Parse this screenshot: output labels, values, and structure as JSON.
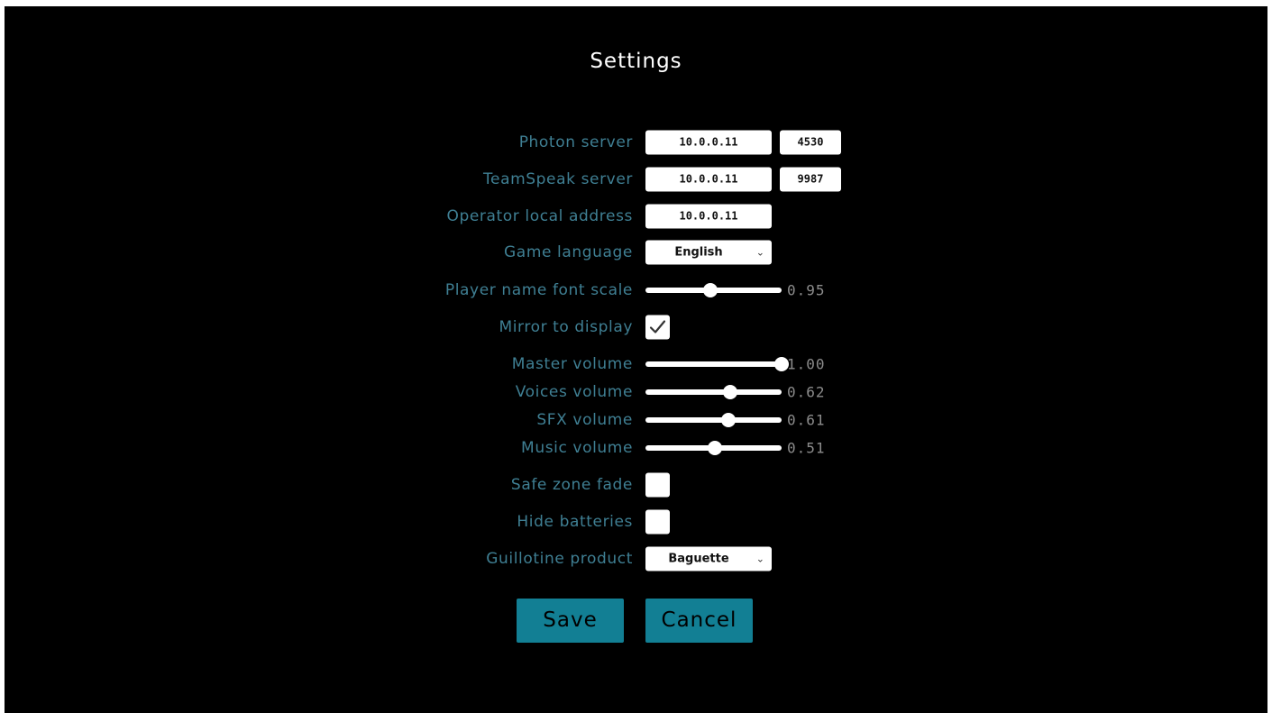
{
  "title": "Settings",
  "photon_server": {
    "label": "Photon server",
    "address": "10.0.0.11",
    "port": "4530"
  },
  "teamspeak_server": {
    "label": "TeamSpeak server",
    "address": "10.0.0.11",
    "port": "9987"
  },
  "operator_local_address": {
    "label": "Operator local address",
    "address": "10.0.0.11"
  },
  "game_language": {
    "label": "Game language",
    "selected": "English",
    "arrow_icon": "chevron-down-icon"
  },
  "player_name_font_scale": {
    "label": "Player name font scale",
    "value_text": "0.95",
    "fraction": 0.48
  },
  "mirror_to_display": {
    "label": "Mirror to display",
    "checked": true
  },
  "master_volume": {
    "label": "Master volume",
    "value_text": "1.00",
    "fraction": 1.0
  },
  "voices_volume": {
    "label": "Voices volume",
    "value_text": "0.62",
    "fraction": 0.62
  },
  "sfx_volume": {
    "label": "SFX volume",
    "value_text": "0.61",
    "fraction": 0.61
  },
  "music_volume": {
    "label": "Music volume",
    "value_text": "0.51",
    "fraction": 0.51
  },
  "safe_zone_fade": {
    "label": "Safe zone fade",
    "checked": false
  },
  "hide_batteries": {
    "label": "Hide batteries",
    "checked": false
  },
  "guillotine_product": {
    "label": "Guillotine product",
    "selected": "Baguette",
    "arrow_icon": "chevron-down-icon"
  },
  "buttons": {
    "save": "Save",
    "cancel": "Cancel"
  },
  "colors": {
    "background": "#000000",
    "label": "#3f7f93",
    "title": "#ffffff",
    "button": "#127f94",
    "slider_value": "#8c8c8c"
  }
}
